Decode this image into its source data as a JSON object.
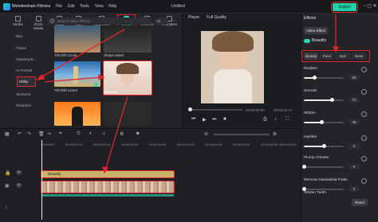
{
  "titlebar": {
    "app_name": "Wondershare Filmora",
    "menus": [
      "File",
      "Edit",
      "Tools",
      "View",
      "Help"
    ],
    "doc_title": "Untitled",
    "export_label": "Export"
  },
  "toolbar": {
    "tabs": [
      "Media",
      "Stock Media",
      "Audio",
      "Titles",
      "Transitions",
      "Effects",
      "Stickers",
      "Templates"
    ]
  },
  "effects_panel": {
    "categories": [
      "Blur",
      "Flicker",
      "Opening B...",
      "AI Portrait",
      "Utility",
      "Starburst",
      "Distortion"
    ],
    "search_placeholder": "Search video effects",
    "filter": "All",
    "thumbnails": [
      {
        "label": "Tilt-shift Circle"
      },
      {
        "label": "Shape Mask"
      },
      {
        "label": "Tilt-shift Linear"
      },
      {
        "label": "Beautify"
      }
    ]
  },
  "player": {
    "label": "Player",
    "quality": "Full Quality",
    "current_time": "00:00:00:00",
    "total_time": "00:00:21:17",
    "progress": 0.0
  },
  "right_panel": {
    "header": "Effects",
    "video_effect_tab": "Video Effect",
    "beautify_label": "Beautify",
    "segments": [
      "Beauty",
      "Face",
      "Eye",
      "Nose"
    ],
    "params": [
      {
        "label": "Redden",
        "value": "26",
        "fraction": 0.26
      },
      {
        "label": "Smooth",
        "value": "70",
        "fraction": 0.7
      },
      {
        "label": "Whiten",
        "value": "45",
        "fraction": 0.45
      },
      {
        "label": "Hairline",
        "value": "0",
        "fraction": 0.5
      },
      {
        "label": "Plump Cheeks",
        "value": "0",
        "fraction": 0.0
      },
      {
        "label": "Remove Nasolabial Folds",
        "value": "0",
        "fraction": 0.0
      },
      {
        "label": "Whiten Teeth",
        "value": "0",
        "fraction": 0.0
      }
    ],
    "reset_label": "Reset"
  },
  "timeline": {
    "ruler": [
      "00:00:00",
      "00:00:04:19",
      "00:00:09:14",
      "00:00:14:09",
      "00:00:19:04",
      "00:00:23:23",
      "00:00:28:18",
      "00:00:33:13",
      "00:00:38:08",
      "00:00:43:04"
    ],
    "effect_clip_label": "Beautify",
    "video_clip_label": ""
  },
  "colors": {
    "accent": "#2fd3b8",
    "highlight": "#e0262b",
    "export": "#1fd0a7"
  }
}
